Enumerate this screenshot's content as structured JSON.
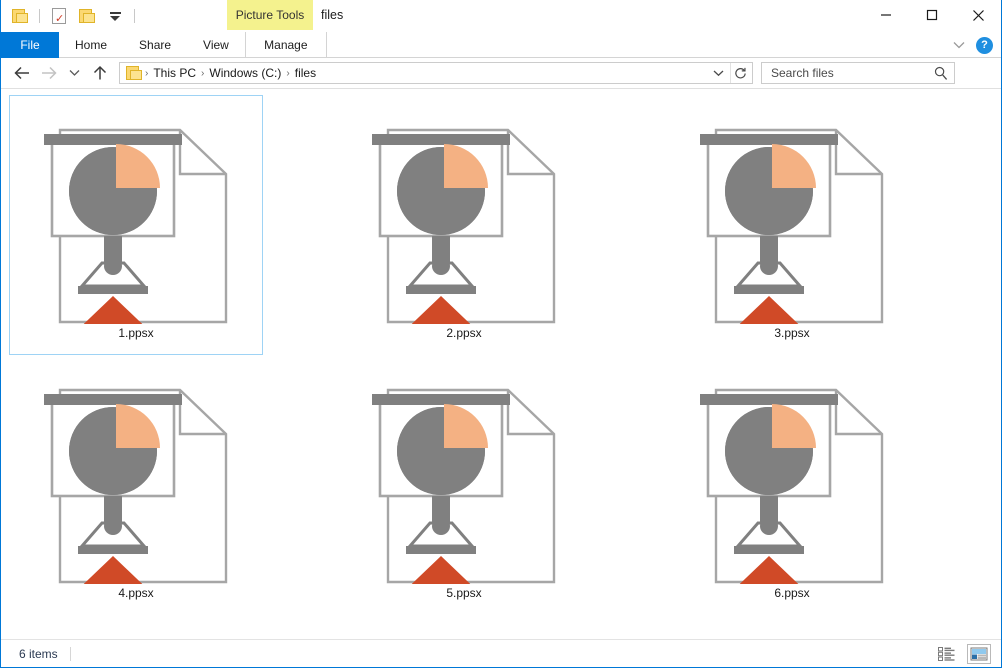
{
  "window": {
    "title": "files",
    "contextual_tab_group": "Picture Tools",
    "minimize_label": "Minimize",
    "maximize_label": "Maximize",
    "close_label": "Close"
  },
  "quick_access": {
    "items": [
      {
        "name": "folder-icon",
        "label": "Folder"
      },
      {
        "name": "properties-icon",
        "label": "Properties"
      },
      {
        "name": "new-folder-icon",
        "label": "New folder"
      },
      {
        "name": "customize-caret-icon",
        "label": "Customize Quick Access Toolbar"
      }
    ]
  },
  "ribbon": {
    "tabs": [
      {
        "label": "File",
        "active": true
      },
      {
        "label": "Home",
        "active": false
      },
      {
        "label": "Share",
        "active": false
      },
      {
        "label": "View",
        "active": false
      },
      {
        "label": "Manage",
        "active": false
      }
    ],
    "collapse_label": "Minimize the Ribbon",
    "help_label": "?"
  },
  "address": {
    "back_label": "Back",
    "forward_label": "Forward",
    "recent_label": "Recent locations",
    "up_label": "Up",
    "crumbs": [
      "This PC",
      "Windows (C:)",
      "files"
    ],
    "separator": "›",
    "dropdown_label": "Previous locations",
    "refresh_label": "Refresh"
  },
  "search": {
    "placeholder": "Search files",
    "value": ""
  },
  "files": [
    {
      "name": "1.ppsx",
      "type": "ppsx",
      "selected": true
    },
    {
      "name": "2.ppsx",
      "type": "ppsx",
      "selected": false
    },
    {
      "name": "3.ppsx",
      "type": "ppsx",
      "selected": false
    },
    {
      "name": "4.ppsx",
      "type": "ppsx",
      "selected": false
    },
    {
      "name": "5.ppsx",
      "type": "ppsx",
      "selected": false
    },
    {
      "name": "6.ppsx",
      "type": "ppsx",
      "selected": false
    }
  ],
  "status": {
    "item_count": "6 items",
    "details_view_label": "Details view",
    "large_icons_view_label": "Large icons view",
    "active_view": "large-icons"
  },
  "colors": {
    "accent": "#0078d7",
    "contextual_tab": "#f4f28e",
    "selection_border": "#9ed3f5",
    "icon_gray": "#808080",
    "icon_outline": "#a6a6a6",
    "icon_accent_peach": "#f4b183",
    "icon_arrow_red": "#d04a27"
  }
}
